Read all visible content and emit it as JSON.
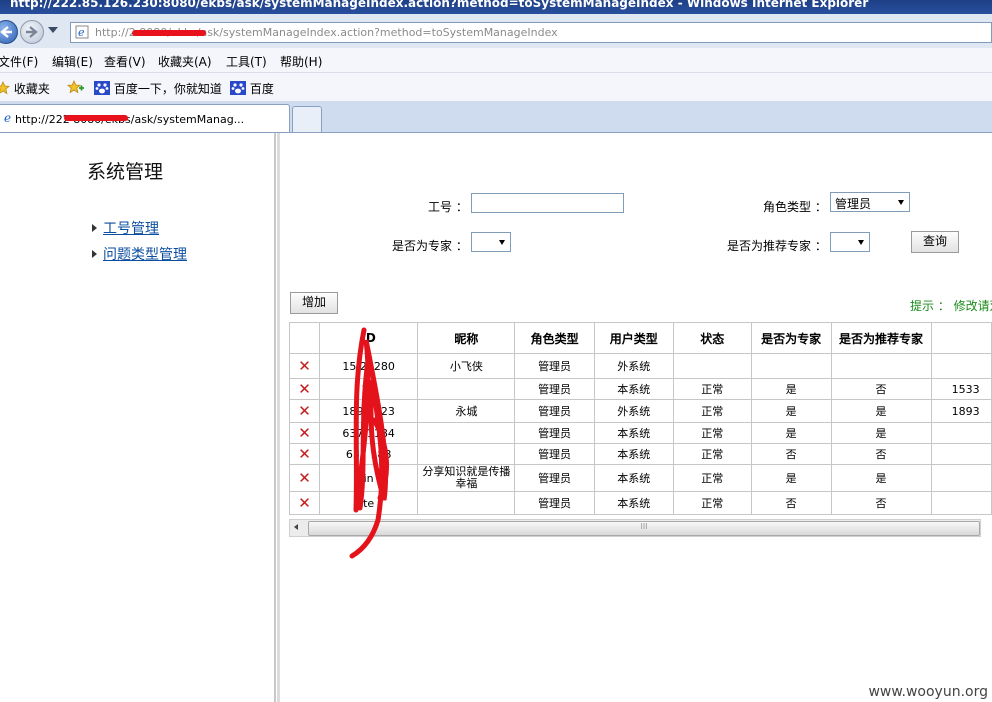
{
  "window": {
    "title": "http://222.85.126.230:8080/ekbs/ask/systemManageIndex.action?method=toSystemManageIndex - Windows Internet Explorer",
    "address": "http://2                    8080/ekbs/ask/systemManageIndex.action?method=toSystemManageIndex"
  },
  "menu": [
    "文件(F)",
    "编辑(E)",
    "查看(V)",
    "收藏夹(A)",
    "工具(T)",
    "帮助(H)"
  ],
  "favorites": {
    "label": "收藏夹",
    "links": [
      "百度一下，你就知道",
      "百度"
    ]
  },
  "tab": {
    "label": "http://222                 8080/ekbs/ask/systemManag..."
  },
  "sidebar": {
    "title": "系统管理",
    "links": [
      "工号管理",
      "问题类型管理"
    ]
  },
  "filters": {
    "id_label": "工号 ：",
    "id_value": "",
    "role_label": "角色类型 ：",
    "role_value": "管理员",
    "expert_label": "是否为专家 ：",
    "expert_value": "",
    "recommend_label": "是否为推荐专家 ：",
    "recommend_value": "",
    "query_button": "查询"
  },
  "toolbar": {
    "add_button": "增加",
    "tip": "提示 ： 修改请双"
  },
  "table": {
    "headers": [
      "",
      "ID",
      "昵称",
      "角色类型",
      "用户类型",
      "状态",
      "是否为专家",
      "是否为推荐专家",
      ""
    ],
    "rows": [
      [
        "15  22280",
        "小飞侠",
        "管理员",
        "外系统",
        "",
        "",
        "",
        ""
      ],
      [
        "  23",
        "",
        "管理员",
        "本系统",
        "正常",
        "是",
        "否",
        "1533"
      ],
      [
        "189  8123",
        "永城",
        "管理员",
        "外系统",
        "正常",
        "是",
        "是",
        "1893"
      ],
      [
        "637  1184",
        "",
        "管理员",
        "本系统",
        "正常",
        "是",
        "是",
        ""
      ],
      [
        "637  188",
        "",
        "管理员",
        "本系统",
        "正常",
        "否",
        "否",
        ""
      ],
      [
        "  in",
        "分享知识就是传播幸福",
        "管理员",
        "本系统",
        "正常",
        "是",
        "是",
        ""
      ],
      [
        "te",
        "",
        "管理员",
        "本系统",
        "正常",
        "否",
        "否",
        ""
      ]
    ]
  },
  "scroll_grip": "III",
  "watermark": "www.wooyun.org"
}
